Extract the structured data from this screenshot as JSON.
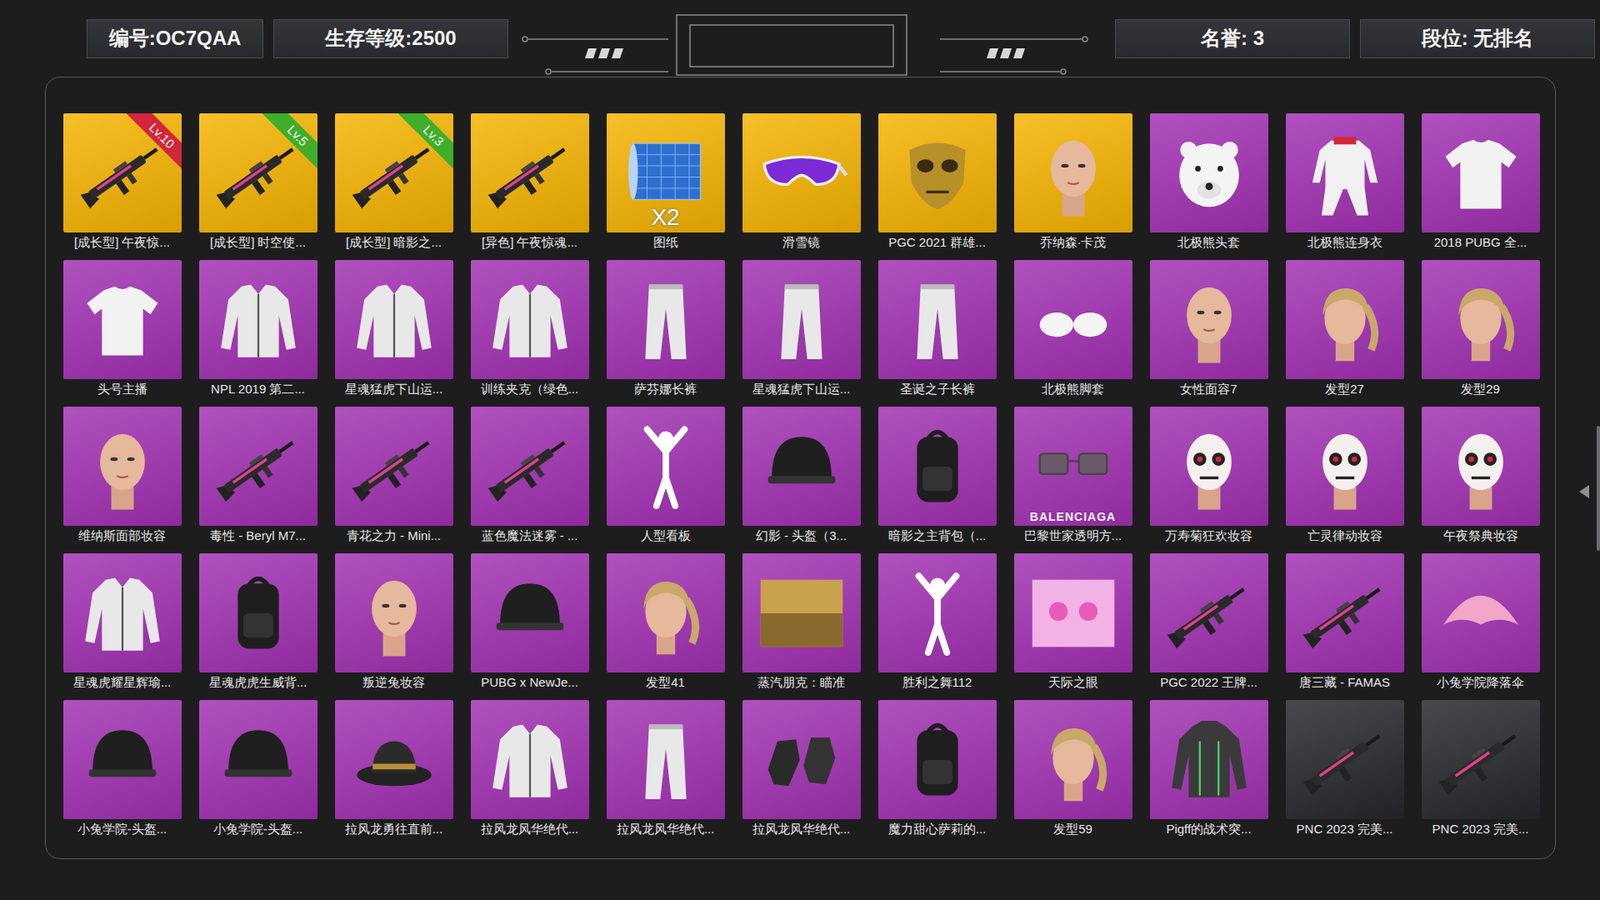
{
  "header": {
    "id": "编号:OC7QAA",
    "level": "生存等级:2500",
    "honor": "名誉: 3",
    "rank": "段位: 无排名"
  },
  "items": [
    {
      "name": "[成长型] 午夜惊...",
      "color": "#f6b400",
      "kind": "gun",
      "badge": {
        "text": "Lv.10",
        "color": "#d4263a"
      }
    },
    {
      "name": "[成长型] 时空使...",
      "color": "#f6b400",
      "kind": "gun",
      "badge": {
        "text": "Lv.5",
        "color": "#3fae2a"
      }
    },
    {
      "name": "[成长型] 暗影之...",
      "color": "#f6b400",
      "kind": "gun",
      "badge": {
        "text": "Lv.3",
        "color": "#3fae2a"
      }
    },
    {
      "name": "[异色] 午夜惊魂...",
      "color": "#f6b400",
      "kind": "gun"
    },
    {
      "name": "图纸",
      "color": "#f6b400",
      "kind": "blueprint",
      "overlay": "X2"
    },
    {
      "name": "滑雪镜",
      "color": "#f6b400",
      "kind": "goggles"
    },
    {
      "name": "PGC 2021 群雄...",
      "color": "#f6b400",
      "kind": "mask"
    },
    {
      "name": "乔纳森·卡茂",
      "color": "#f6b400",
      "kind": "face"
    },
    {
      "name": "北极熊头套",
      "color": "#a230b3",
      "kind": "bear-head"
    },
    {
      "name": "北极熊连身衣",
      "color": "#a230b3",
      "kind": "suit"
    },
    {
      "name": "2018 PUBG 全...",
      "color": "#a230b3",
      "kind": "shirt"
    },
    {
      "name": "头号主播",
      "color": "#a230b3",
      "kind": "shirt"
    },
    {
      "name": "NPL 2019 第二...",
      "color": "#a230b3",
      "kind": "jacket"
    },
    {
      "name": "星魂猛虎下山运...",
      "color": "#a230b3",
      "kind": "jacket"
    },
    {
      "name": "训练夹克（绿色...",
      "color": "#a230b3",
      "kind": "jacket"
    },
    {
      "name": "萨芬娜长裤",
      "color": "#a230b3",
      "kind": "pants"
    },
    {
      "name": "星魂猛虎下山运...",
      "color": "#a230b3",
      "kind": "pants"
    },
    {
      "name": "圣诞之子长裤",
      "color": "#a230b3",
      "kind": "pants"
    },
    {
      "name": "北极熊脚套",
      "color": "#a230b3",
      "kind": "paws"
    },
    {
      "name": "女性面容7",
      "color": "#a230b3",
      "kind": "face"
    },
    {
      "name": "发型27",
      "color": "#a230b3",
      "kind": "hair"
    },
    {
      "name": "发型29",
      "color": "#a230b3",
      "kind": "hair"
    },
    {
      "name": "维纳斯面部妆容",
      "color": "#a230b3",
      "kind": "face"
    },
    {
      "name": "毒性 - Beryl M7...",
      "color": "#a230b3",
      "kind": "gun"
    },
    {
      "name": "青花之力 - Mini...",
      "color": "#a230b3",
      "kind": "gun"
    },
    {
      "name": "蓝色魔法迷雾 - ...",
      "color": "#a230b3",
      "kind": "gun"
    },
    {
      "name": "人型看板",
      "color": "#a230b3",
      "kind": "emote"
    },
    {
      "name": "幻影 - 头盔（3...",
      "color": "#a230b3",
      "kind": "helmet"
    },
    {
      "name": "暗影之主背包（...",
      "color": "#a230b3",
      "kind": "backpack"
    },
    {
      "name": "巴黎世家透明方...",
      "color": "#a230b3",
      "kind": "glasses",
      "overlay": "BALENCIAGA"
    },
    {
      "name": "万寿菊狂欢妆容",
      "color": "#a230b3",
      "kind": "makeup"
    },
    {
      "name": "亡灵律动妆容",
      "color": "#a230b3",
      "kind": "makeup"
    },
    {
      "name": "午夜祭典妆容",
      "color": "#a230b3",
      "kind": "makeup"
    },
    {
      "name": "星魂虎耀星辉瑜...",
      "color": "#a230b3",
      "kind": "jacket"
    },
    {
      "name": "星魂虎虎生威背...",
      "color": "#a230b3",
      "kind": "backpack"
    },
    {
      "name": "叛逆兔妆容",
      "color": "#a230b3",
      "kind": "face"
    },
    {
      "name": "PUBG x NewJe...",
      "color": "#a230b3",
      "kind": "helmet"
    },
    {
      "name": "发型41",
      "color": "#a230b3",
      "kind": "hair"
    },
    {
      "name": "蒸汽朋克：瞄准",
      "color": "#a230b3",
      "kind": "scene"
    },
    {
      "name": "胜利之舞112",
      "color": "#a230b3",
      "kind": "emote"
    },
    {
      "name": "天际之眼",
      "color": "#a230b3",
      "kind": "banner"
    },
    {
      "name": "PGC 2022 王牌...",
      "color": "#a230b3",
      "kind": "gun"
    },
    {
      "name": "唐三藏 - FAMAS",
      "color": "#a230b3",
      "kind": "gun"
    },
    {
      "name": "小兔学院降落伞",
      "color": "#a230b3",
      "kind": "parachute"
    },
    {
      "name": "小兔学院-头盔...",
      "color": "#a230b3",
      "kind": "helmet"
    },
    {
      "name": "小兔学院-头盔...",
      "color": "#a230b3",
      "kind": "helmet"
    },
    {
      "name": "拉风龙勇往直前...",
      "color": "#a230b3",
      "kind": "hat"
    },
    {
      "name": "拉风龙风华绝代...",
      "color": "#a230b3",
      "kind": "jacket"
    },
    {
      "name": "拉风龙风华绝代...",
      "color": "#a230b3",
      "kind": "pants"
    },
    {
      "name": "拉风龙风华绝代...",
      "color": "#a230b3",
      "kind": "gloves"
    },
    {
      "name": "魔力甜心萨莉的...",
      "color": "#a230b3",
      "kind": "backpack"
    },
    {
      "name": "发型59",
      "color": "#a230b3",
      "kind": "hair"
    },
    {
      "name": "Pigff的战术突...",
      "color": "#a230b3",
      "kind": "hoodie"
    },
    {
      "name": "PNC 2023 完美...",
      "color": "#26272b",
      "kind": "gun"
    },
    {
      "name": "PNC 2023 完美...",
      "color": "#26272b",
      "kind": "gun"
    }
  ]
}
